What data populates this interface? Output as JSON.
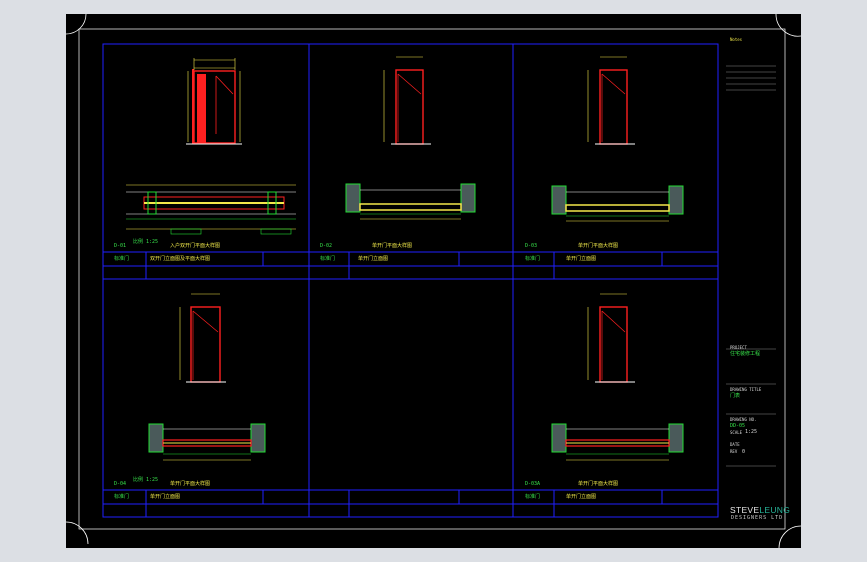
{
  "sheet": {
    "panels": [
      {
        "code": "D-01",
        "sub": "标准门",
        "title": "入户双开门平面大样图",
        "desc": "双开门立面图及平面大样图",
        "scale": "比例 1:25"
      },
      {
        "code": "D-02",
        "sub": "标准门",
        "title": "单开门平面大样图",
        "desc": "单开门立面图",
        "scale": ""
      },
      {
        "code": "D-03",
        "sub": "标准门",
        "title": "单开门平面大样图",
        "desc": "单开门立面图",
        "scale": ""
      },
      {
        "code": "D-04",
        "sub": "标准门",
        "title": "单开门平面大样图",
        "desc": "单开门立面图",
        "scale": "比例 1:25"
      },
      {
        "code": "",
        "sub": "",
        "title": "",
        "desc": "",
        "scale": ""
      },
      {
        "code": "D-03A",
        "sub": "标准门",
        "title": "单开门平面大样图",
        "desc": "单开门立面图",
        "scale": ""
      }
    ],
    "view_label": "1:25",
    "elevation_label": "立面图",
    "plan_label": "平面图"
  },
  "title_block": {
    "notes_heading": "Notes",
    "project_label": "PROJECT",
    "project_name": "住宅装修工程",
    "drawing_title_label": "DRAWING TITLE",
    "drawing_title": "门表",
    "drawing_no_label": "DRAWING NO.",
    "drawing_no": "DD-05",
    "scale_label": "SCALE",
    "scale": "1:25",
    "date_label": "DATE",
    "rev_label": "REV",
    "rev": "0",
    "firm_name_1": "STEVE",
    "firm_name_2": "LEUNG",
    "firm_sub": "DESIGNERS LTD"
  },
  "colors": {
    "background": "#000000",
    "frame": "#0000ff",
    "red": "#ff2020",
    "green": "#22dd33",
    "yellow": "#f5e94a",
    "white": "#e0e0e0",
    "canvas": "#dcdfe4"
  }
}
